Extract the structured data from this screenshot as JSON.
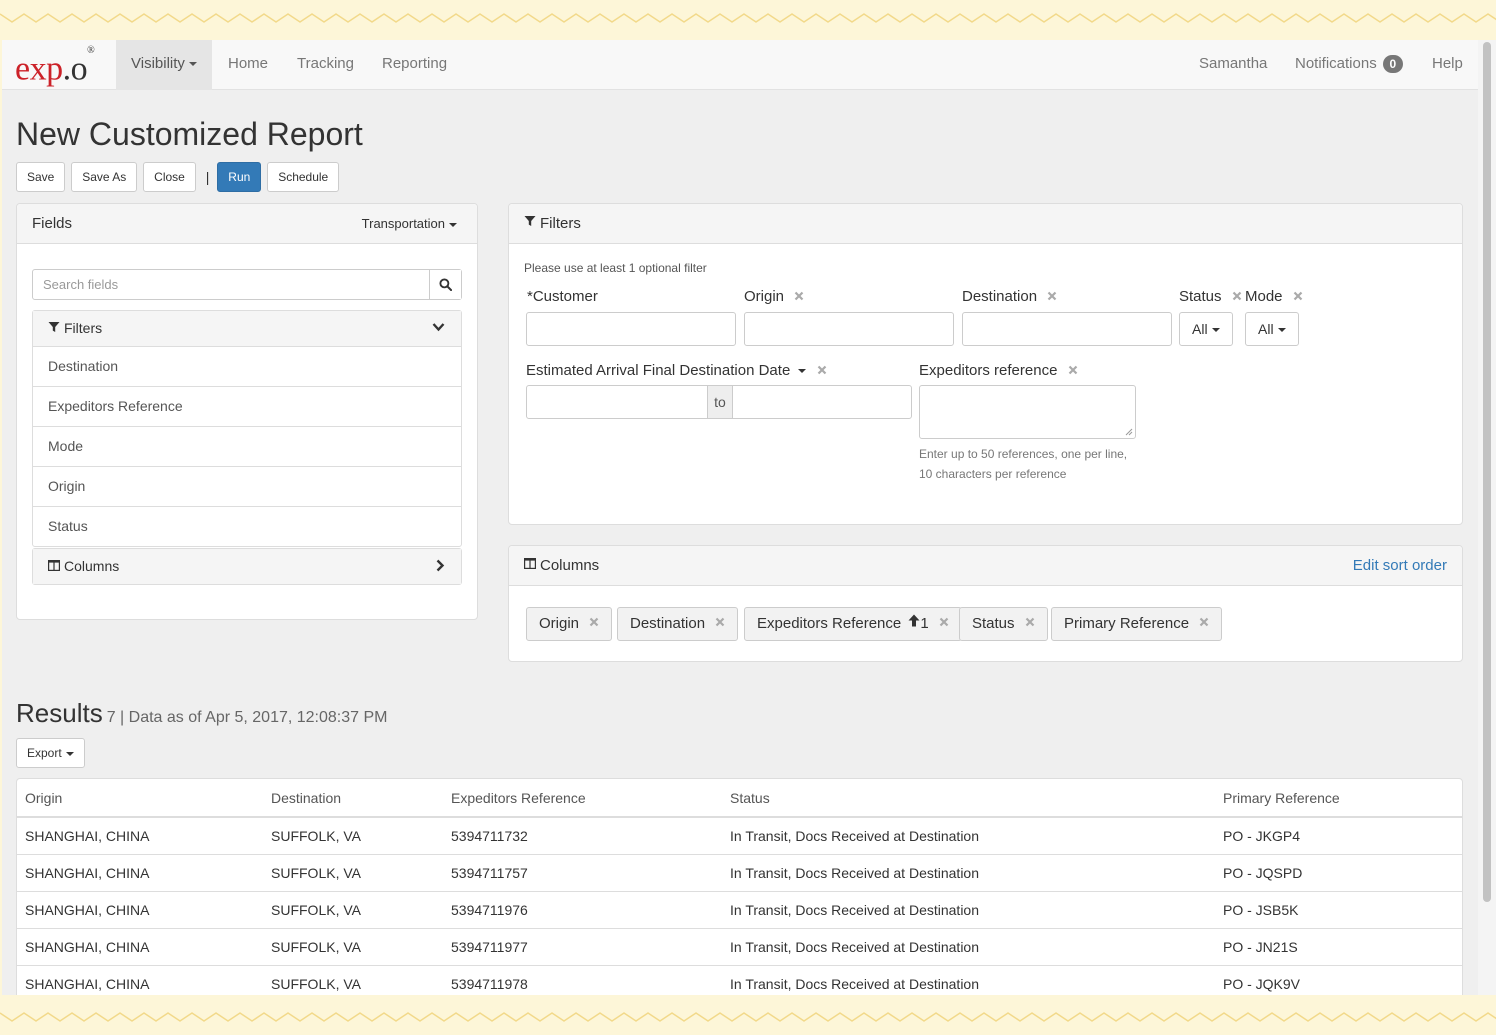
{
  "colors": {
    "accent": "#337ab7",
    "brand_red": "#cc2229"
  },
  "nav": {
    "logo_main": "exp",
    "logo_dot": ".o",
    "logo_mark": "®",
    "visibility": "Visibility",
    "home": "Home",
    "tracking": "Tracking",
    "reporting": "Reporting",
    "user": "Samantha",
    "notifications": "Notifications",
    "notifications_count": "0",
    "help": "Help"
  },
  "page": {
    "title": "New Customized Report",
    "toolbar": {
      "save": "Save",
      "save_as": "Save As",
      "close": "Close",
      "sep": "|",
      "run": "Run",
      "schedule": "Schedule"
    }
  },
  "fields_panel": {
    "title": "Fields",
    "category": "Transportation",
    "search_placeholder": "Search fields",
    "filters_label": "Filters",
    "filters_items": [
      "Destination",
      "Expeditors Reference",
      "Mode",
      "Origin",
      "Status"
    ],
    "columns_label": "Columns"
  },
  "filters_panel": {
    "title": "Filters",
    "hint": "Please use at least 1 optional filter",
    "customer": "*Customer",
    "origin": "Origin",
    "destination": "Destination",
    "status": "Status",
    "status_value": "All",
    "mode": "Mode",
    "mode_value": "All",
    "eta_label": "Estimated Arrival Final Destination Date",
    "to": "to",
    "ref_label": "Expeditors reference",
    "ref_help_1": "Enter up to 50 references, one per line,",
    "ref_help_2": "10 characters per reference"
  },
  "columns_panel": {
    "title": "Columns",
    "edit_sort": "Edit sort order",
    "chips": [
      "Origin",
      "Destination",
      "Expeditors Reference",
      "Status",
      "Primary Reference"
    ],
    "sort_index": "1"
  },
  "results": {
    "title": "Results",
    "meta": "7 | Data as of Apr 5, 2017, 12:08:37 PM",
    "export": "Export",
    "headers": [
      "Origin",
      "Destination",
      "Expeditors Reference",
      "Status",
      "Primary Reference"
    ],
    "rows": [
      [
        "SHANGHAI, CHINA",
        "SUFFOLK, VA",
        "5394711732",
        "In Transit, Docs Received at Destination",
        "PO - JKGP4"
      ],
      [
        "SHANGHAI, CHINA",
        "SUFFOLK, VA",
        "5394711757",
        "In Transit, Docs Received at Destination",
        "PO - JQSPD"
      ],
      [
        "SHANGHAI, CHINA",
        "SUFFOLK, VA",
        "5394711976",
        "In Transit, Docs Received at Destination",
        "PO - JSB5K"
      ],
      [
        "SHANGHAI, CHINA",
        "SUFFOLK, VA",
        "5394711977",
        "In Transit, Docs Received at Destination",
        "PO - JN21S"
      ],
      [
        "SHANGHAI, CHINA",
        "SUFFOLK, VA",
        "5394711978",
        "In Transit, Docs Received at Destination",
        "PO - JQK9V"
      ]
    ]
  }
}
